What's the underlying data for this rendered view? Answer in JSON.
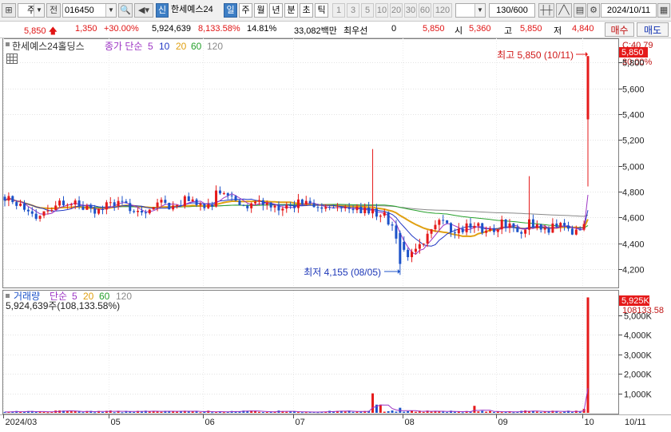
{
  "toolbar": {
    "market": "주",
    "period_mode": "전",
    "code": "016450",
    "new_badge": "신",
    "stock_name": "한세예스24",
    "period_tabs": [
      "일",
      "주",
      "월",
      "년",
      "분",
      "초",
      "틱"
    ],
    "active_period": "일",
    "minute_intervals": [
      "1",
      "3",
      "5",
      "10",
      "20",
      "30",
      "60",
      "120"
    ],
    "count": "130/600",
    "date": "2024/10/11"
  },
  "quote": {
    "price": "5,850",
    "change": "1,350",
    "change_pct": "+30.00%",
    "volume": "5,924,639",
    "volume_ratio": "8,133.58%",
    "turnover": "14.81%",
    "trade_value": "33,082백만",
    "best_label": "최우선",
    "best_value": "0",
    "best_price": "5,850",
    "open_label": "시",
    "open": "5,360",
    "high_label": "고",
    "high": "5,850",
    "low_label": "저",
    "low": "4,840",
    "buy_label": "매수",
    "sell_label": "매도"
  },
  "price_panel": {
    "title": "한세예스24홀딩스",
    "ma_label": "종가 단순",
    "ma_periods": [
      "5",
      "10",
      "20",
      "60",
      "120"
    ],
    "current_value": "5,850",
    "pct_label": "30.00%",
    "top_label": "C:40.79",
    "high_annotation": "최고 5,850 (10/11)",
    "low_annotation": "최저 4,155 (08/05)"
  },
  "volume_panel": {
    "title": "거래량",
    "ma_label": "단순",
    "ma_periods": [
      "5",
      "20",
      "60",
      "120"
    ],
    "current_volume": "5,924,639주(108,133.58%)",
    "current_value": "5,925K",
    "sub_value": "108133.58"
  },
  "colors": {
    "up": "#e51a1a",
    "down": "#1d53c9",
    "ma5": "#9c34c4",
    "ma10": "#2138c4",
    "ma20": "#e0a012",
    "ma60": "#27a12d",
    "ma120": "#8a8a8a",
    "button_selected": "#3d7ec5"
  },
  "chart_data": [
    {
      "type": "candlestick",
      "title": "한세예스24홀딩스",
      "x_tick_labels": [
        "2024/03",
        "05",
        "06",
        "07",
        "08",
        "09",
        "10",
        "10/11"
      ],
      "y_tick_labels": [
        "4,200",
        "4,400",
        "4,600",
        "4,800",
        "5,000",
        "5,200",
        "5,400",
        "5,600",
        "5,800"
      ],
      "ylim": [
        4120,
        6100
      ],
      "grid": true,
      "series_notes": [
        "종가 단순 5",
        "10",
        "20",
        "60",
        "120"
      ],
      "key_points": [
        {
          "date": "08/05",
          "value": 4155,
          "label": "최저"
        },
        {
          "date": "10/11",
          "value": 5850,
          "label": "최고"
        }
      ],
      "last_candle": {
        "date": "2024/10/11",
        "open": 5360,
        "high": 5850,
        "low": 4840,
        "close": 5850
      }
    },
    {
      "type": "bar",
      "title": "거래량",
      "y_tick_labels": [
        "1,000K",
        "2,000K",
        "3,000K",
        "4,000K",
        "5,000K"
      ],
      "ylim": [
        0,
        6000000
      ],
      "last_value": 5924639
    }
  ]
}
